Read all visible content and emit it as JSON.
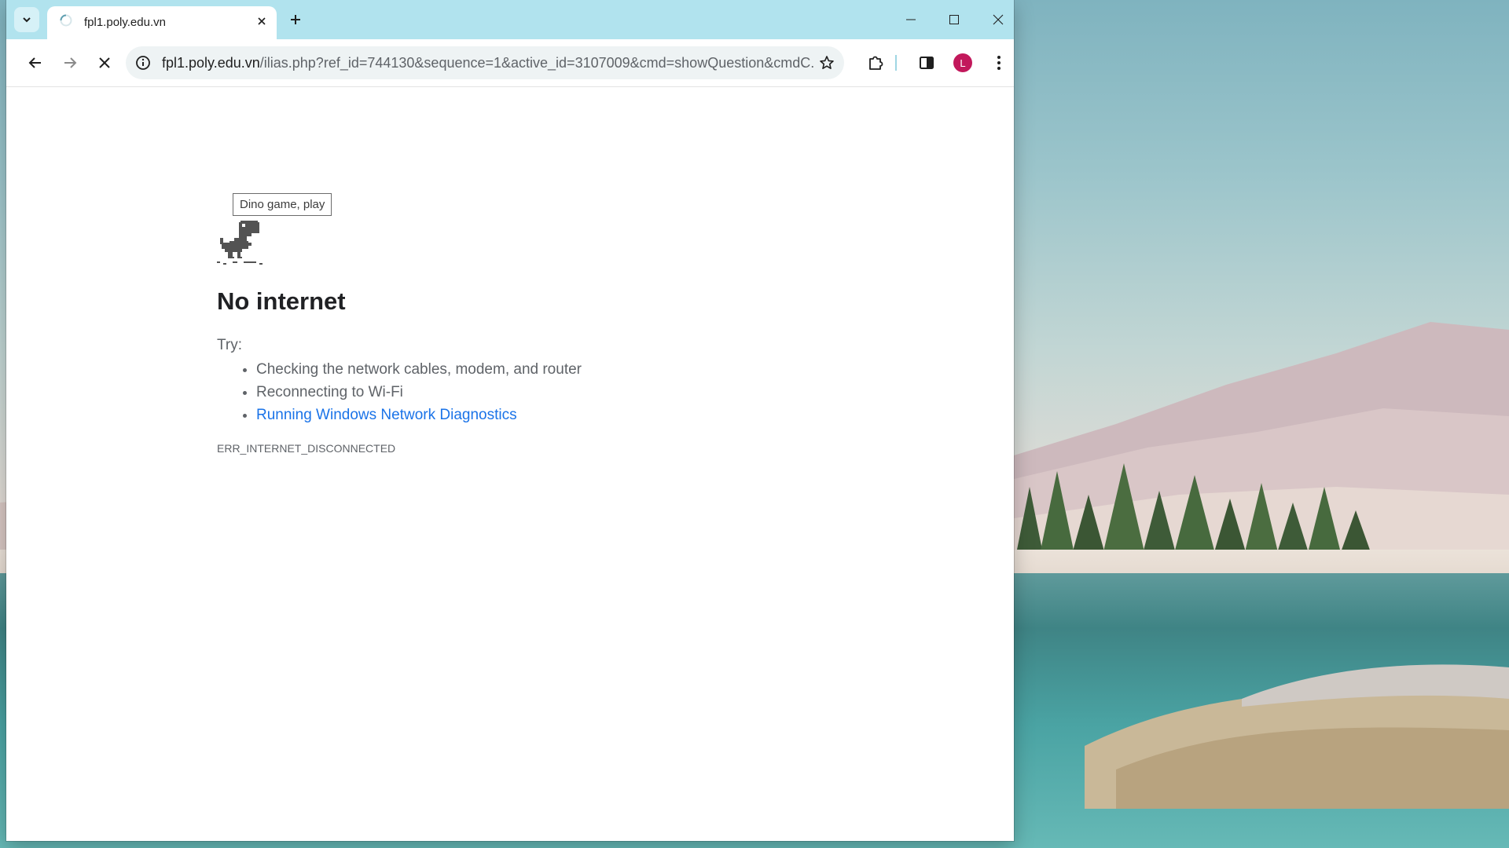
{
  "browser": {
    "tab": {
      "title": "fpl1.poly.edu.vn"
    },
    "address_bar": {
      "host": "fpl1.poly.edu.vn",
      "path": "/ilias.php?ref_id=744130&sequence=1&active_id=3107009&cmd=showQuestion&cmdC..."
    },
    "profile": {
      "initial": "L",
      "color": "#c2185b"
    }
  },
  "page": {
    "tooltip": "Dino game, play",
    "title": "No internet",
    "try_label": "Try:",
    "suggestions": [
      "Checking the network cables, modem, and router",
      "Reconnecting to Wi-Fi",
      "Running Windows Network Diagnostics"
    ],
    "error_code": "ERR_INTERNET_DISCONNECTED"
  },
  "colors": {
    "titlebar": "#b1e3ee",
    "link": "#1a73e8"
  },
  "icons": {
    "tab_search": "chevron-down-icon",
    "loading": "spinner-icon",
    "tab_close": "close-icon",
    "new_tab": "plus-icon",
    "minimize": "minimize-icon",
    "maximize": "maximize-icon",
    "close_window": "close-icon",
    "back": "arrow-left-icon",
    "forward": "arrow-right-icon",
    "stop": "close-icon",
    "site_info": "info-icon",
    "bookmark": "star-icon",
    "extensions": "puzzle-icon",
    "side_panel": "side-panel-icon",
    "menu": "kebab-menu-icon",
    "dino": "dino-icon"
  }
}
